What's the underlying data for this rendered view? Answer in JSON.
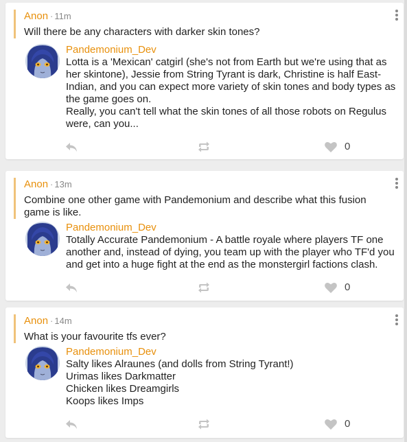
{
  "posts": [
    {
      "question": {
        "author": "Anon",
        "separator": "·",
        "time": "11m",
        "text": "Will there be any characters with darker skin tones?"
      },
      "answer": {
        "author": "Pandemonium_Dev",
        "text": "Lotta is a 'Mexican' catgirl (she's not from Earth but we're using that as her skintone), Jessie from String Tyrant is dark, Christine is half East-Indian, and you can expect more variety of skin tones and body types as the game goes on.\nReally, you can't tell what the skin tones of all those robots on Regulus were, can you..."
      },
      "likes": "0"
    },
    {
      "question": {
        "author": "Anon",
        "separator": "·",
        "time": "13m",
        "text": "Combine one other game with Pandemonium and describe what this fusion game is like."
      },
      "answer": {
        "author": "Pandemonium_Dev",
        "text": "Totally Accurate Pandemonium - A battle royale where players TF one another and, instead of dying, you team up with the player who TF'd you and get into a huge fight at the end as the monstergirl factions clash."
      },
      "likes": "0"
    },
    {
      "question": {
        "author": "Anon",
        "separator": "·",
        "time": "14m",
        "text": "What is your favourite tfs ever?"
      },
      "answer": {
        "author": "Pandemonium_Dev",
        "text": "Salty likes Alraunes (and dolls from String Tyrant!)\nUrimas likes Darkmatter\nChicken likes Dreamgirls\nKoops likes Imps"
      },
      "likes": "0"
    }
  ],
  "icons": {
    "menu": "more-vertical-icon",
    "reply": "reply-icon",
    "share": "share-icon",
    "like": "heart-icon",
    "avatar": "avatar-image"
  },
  "colors": {
    "author": "#e8900c",
    "quote_bar": "#f0c27a",
    "icon": "#c4c4c4",
    "background": "#ededed"
  }
}
